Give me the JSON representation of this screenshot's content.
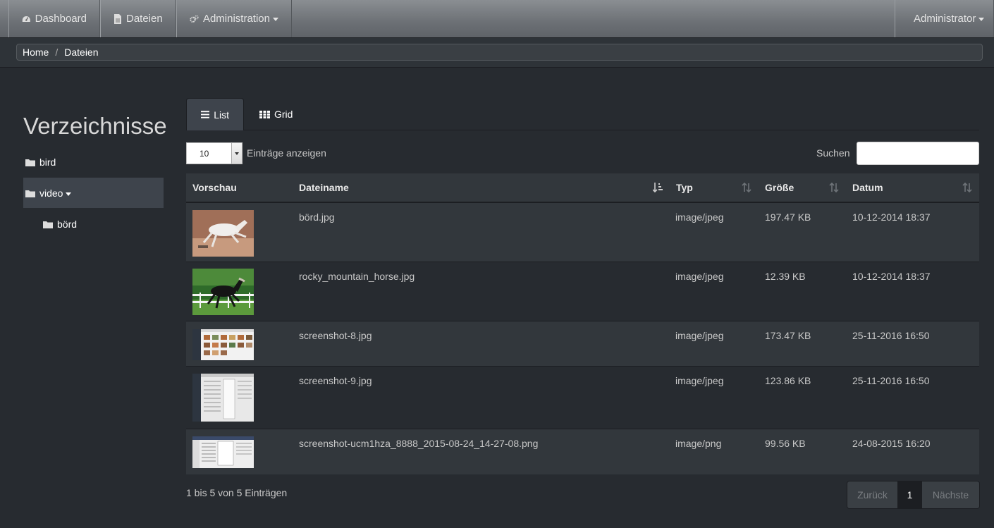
{
  "nav": {
    "dashboard": "Dashboard",
    "files": "Dateien",
    "admin": "Administration",
    "user": "Administrator"
  },
  "breadcrumb": {
    "home": "Home",
    "current": "Dateien"
  },
  "sidebar": {
    "title": "Verzeichnisse",
    "items": [
      {
        "label": "bird",
        "icon": "folder-icon"
      },
      {
        "label": "video",
        "icon": "folder-icon",
        "active": true,
        "expanded": true
      },
      {
        "label": "börd",
        "icon": "folder-icon",
        "child": true
      }
    ]
  },
  "view_tabs": {
    "list": "List",
    "grid": "Grid",
    "active": "List"
  },
  "controls": {
    "page_length": "10",
    "page_length_label": "Einträge anzeigen",
    "search_label": "Suchen",
    "search_value": ""
  },
  "table": {
    "headers": {
      "preview": "Vorschau",
      "name": "Dateiname",
      "type": "Typ",
      "size": "Größe",
      "date": "Datum"
    },
    "rows": [
      {
        "name": "börd.jpg",
        "type": "image/jpeg",
        "size": "197.47 KB",
        "date": "10-12-2014 18:37",
        "thumb": "white-horse"
      },
      {
        "name": "rocky_mountain_horse.jpg",
        "type": "image/jpeg",
        "size": "12.39 KB",
        "date": "10-12-2014 18:37",
        "thumb": "black-horse"
      },
      {
        "name": "screenshot-8.jpg",
        "type": "image/jpeg",
        "size": "173.47 KB",
        "date": "25-11-2016 16:50",
        "thumb": "screenshot"
      },
      {
        "name": "screenshot-9.jpg",
        "type": "image/jpeg",
        "size": "123.86 KB",
        "date": "25-11-2016 16:50",
        "thumb": "screenshot"
      },
      {
        "name": "screenshot-ucm1hza_8888_2015-08-24_14-27-08.png",
        "type": "image/png",
        "size": "99.56 KB",
        "date": "24-08-2015 16:20",
        "thumb": "screenshot"
      }
    ]
  },
  "footer": {
    "info": "1 bis 5 von 5 Einträgen",
    "prev": "Zurück",
    "page": "1",
    "next": "Nächste"
  }
}
